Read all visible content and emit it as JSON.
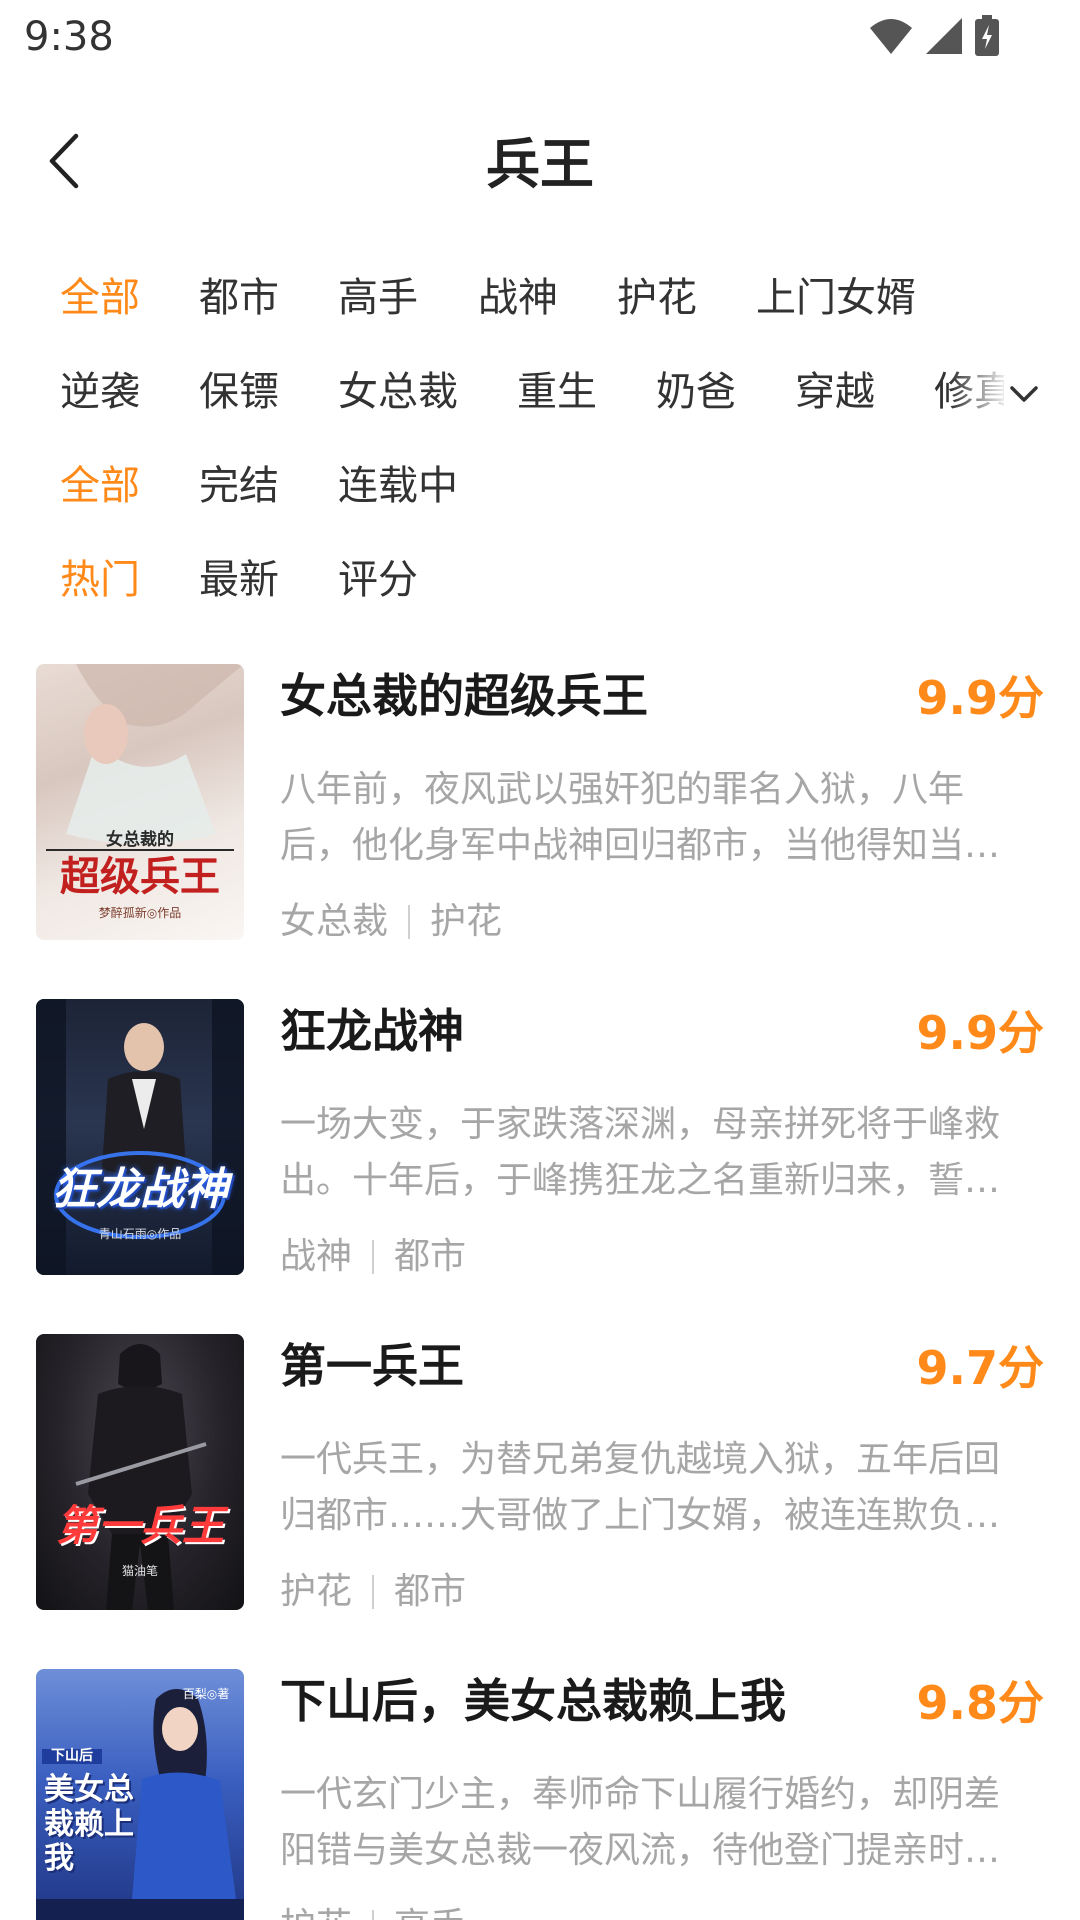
{
  "status_bar": {
    "time": "9:38",
    "icons": [
      "wifi-icon",
      "signal-icon",
      "battery-charging-icon"
    ]
  },
  "header": {
    "title": "兵王",
    "back_icon": "chevron-left-icon"
  },
  "filters": {
    "genre_row_1": [
      "全部",
      "都市",
      "高手",
      "战神",
      "护花",
      "上门女婿"
    ],
    "genre_row_2": [
      "逆袭",
      "保镖",
      "女总裁",
      "重生",
      "奶爸",
      "穿越",
      "修真"
    ],
    "status_row": [
      "全部",
      "完结",
      "连载中"
    ],
    "sort_row": [
      "热门",
      "最新",
      "评分"
    ],
    "expand_icon": "chevron-down-icon",
    "active_color": "#ff8a1a"
  },
  "books": [
    {
      "title": "女总裁的超级兵王",
      "score": "9.9分",
      "description": "八年前，夜风武以强奸犯的罪名入狱，八年后，他化身军中战神回归都市，当他得知当年的真相，他誓要让那些人付出代价",
      "tags": [
        "女总裁",
        "护花"
      ],
      "cover": {
        "title_small": "女总裁的",
        "title_big": "超级兵王",
        "author": "梦醉孤新◎作品"
      }
    },
    {
      "title": "狂龙战神",
      "score": "9.9分",
      "description": "一场大变，于家跌落深渊，母亲拼死将于峰救出。十年后，于峰携狂龙之名重新归来，誓要让仇人血债血偿",
      "tags": [
        "战神",
        "都市"
      ],
      "cover": {
        "title_big": "狂龙战神",
        "author": "青山石雨◎作品"
      }
    },
    {
      "title": "第一兵王",
      "score": "9.7分",
      "description": "一代兵王，为替兄弟复仇越境入狱，五年后回归都市……大哥做了上门女婿，被连连欺负，他要为大哥讨回公道",
      "tags": [
        "护花",
        "都市"
      ],
      "cover": {
        "title_big": "第一兵王",
        "author": "猫油笔"
      }
    },
    {
      "title": "下山后，美女总裁赖上我",
      "score": "9.8分",
      "description": "一代玄门少主，奉师命下山履行婚约，却阴差阳错与美女总裁一夜风流，待他登门提亲时才发现",
      "tags": [
        "护花",
        "高手"
      ],
      "cover": {
        "title_small": "下山后",
        "title_big": "美女总裁赖上我",
        "author": "百梨◎著"
      }
    }
  ],
  "colors": {
    "accent": "#ff8a1a",
    "text_primary": "#1a1a1a",
    "text_secondary": "#a6a6a6"
  }
}
